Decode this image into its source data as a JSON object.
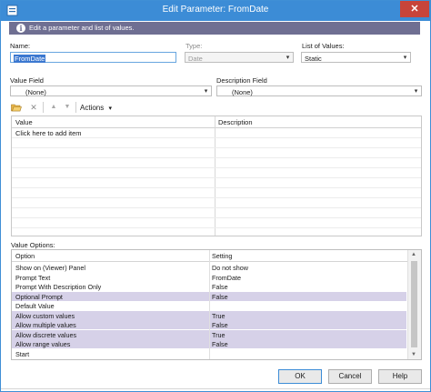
{
  "window": {
    "title": "Edit Parameter: FromDate",
    "close_glyph": "✕"
  },
  "info": {
    "text": "Edit a parameter and list of values.",
    "icon": "info-icon",
    "glyph": "i"
  },
  "name": {
    "label": "Name:",
    "value": "FromDate"
  },
  "type": {
    "label": "Type:",
    "value": "Date"
  },
  "list_of_values": {
    "label": "List of Values:",
    "value": "Static"
  },
  "value_field": {
    "label": "Value Field",
    "value": "(None)"
  },
  "description_field": {
    "label": "Description Field",
    "value": "(None)"
  },
  "toolbar": {
    "actions_label": "Actions",
    "icons": [
      "open-folder-icon",
      "delete-icon",
      "move-up-icon",
      "move-down-icon"
    ]
  },
  "values_grid": {
    "columns": [
      "Value",
      "Description"
    ],
    "rows": [
      "Click here to add item"
    ]
  },
  "value_options": {
    "label": "Value Options:",
    "columns": [
      "Option",
      "Setting"
    ],
    "rows": [
      {
        "option": "Show on (Viewer) Panel",
        "setting": "Do not show",
        "highlight": false
      },
      {
        "option": "Prompt Text",
        "setting": "FromDate",
        "highlight": false
      },
      {
        "option": "Prompt With Description Only",
        "setting": "False",
        "highlight": false
      },
      {
        "option": "Optional Prompt",
        "setting": "False",
        "highlight": true
      },
      {
        "option": "Default Value",
        "setting": "",
        "highlight": false
      },
      {
        "option": "Allow custom values",
        "setting": "True",
        "highlight": true
      },
      {
        "option": "Allow multiple values",
        "setting": "False",
        "highlight": true
      },
      {
        "option": "Allow discrete values",
        "setting": "True",
        "highlight": true
      },
      {
        "option": "Allow range values",
        "setting": "False",
        "highlight": true
      },
      {
        "option": "Start",
        "setting": "",
        "highlight": false
      }
    ]
  },
  "buttons": {
    "ok": "OK",
    "cancel": "Cancel",
    "help": "Help"
  },
  "colors": {
    "titlebar": "#3c8cd6",
    "info_bar": "#6f6f92",
    "row_highlight": "#d6d1e8",
    "selection": "#3b78d0"
  }
}
